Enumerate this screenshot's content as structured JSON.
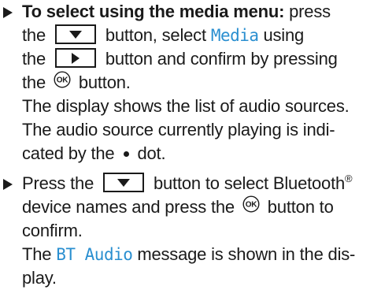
{
  "items": [
    {
      "lines": [
        {
          "bold_prefix": "To select using the media menu:",
          "text_after": " press"
        },
        {
          "before_key": "the",
          "after_key_1": "button, select",
          "display_word": "Media",
          "after_display": "using"
        },
        {
          "before_key": "the",
          "after_key": "button and confirm by pressing"
        },
        {
          "before_ok": "the",
          "after_ok": "button."
        },
        {
          "text": "The display shows the list of audio sources."
        },
        {
          "text": "The audio source currently playing is indi-"
        },
        {
          "before_dot": "cated by the",
          "after_dot": "dot."
        }
      ]
    },
    {
      "lines": [
        {
          "before_key": "Press the",
          "after_key": "button to select Bluetooth",
          "sup": "®"
        },
        {
          "before_ok": "device names and press the",
          "after_ok": "button to"
        },
        {
          "text": "confirm."
        },
        {
          "before_display": "The",
          "display_word": "BT Audio",
          "after_display": "message is shown in the dis-"
        },
        {
          "text": "play."
        }
      ]
    }
  ],
  "icons": {
    "bullet": "triangle-right-bullet-icon",
    "down_button": "arrow-down-button-icon",
    "right_button": "arrow-right-button-icon",
    "ok_button": "ok-button-icon",
    "dot": "dot-icon"
  },
  "colors": {
    "text": "#1a1a1a",
    "display_text": "#2a8fd0"
  }
}
